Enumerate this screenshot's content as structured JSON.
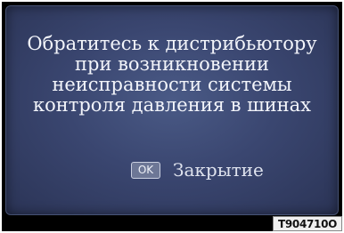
{
  "dialog": {
    "message_lines": [
      "Обратитесь к дистрибьютору",
      "при возникновении",
      "неисправности системы",
      "контроля давления в шинах"
    ],
    "ok_key_label": "OK",
    "close_label": "Закрытие"
  },
  "figure_code": "T904710O",
  "colors": {
    "dialog_background": "#3a4670",
    "frame": "#000000",
    "text": "#f2f4fa"
  }
}
